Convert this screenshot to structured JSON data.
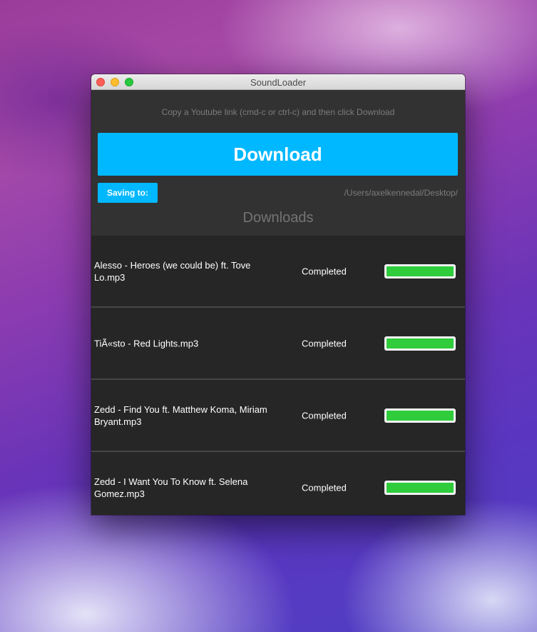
{
  "window": {
    "title": "SoundLoader"
  },
  "header": {
    "instruction": "Copy a Youtube link (cmd-c or ctrl-c) and then click Download",
    "download_label": "Download",
    "saving_label": "Saving to:",
    "save_path": "/Users/axelkennedal/Desktop/",
    "downloads_heading": "Downloads"
  },
  "downloads": [
    {
      "name": "Alesso - Heroes (we could be) ft. Tove Lo.mp3",
      "status": "Completed",
      "progress": 1.0
    },
    {
      "name": "TiÃ«sto - Red Lights.mp3",
      "status": "Completed",
      "progress": 1.0
    },
    {
      "name": "Zedd - Find You ft. Matthew Koma, Miriam Bryant.mp3",
      "status": "Completed",
      "progress": 1.0
    },
    {
      "name": "Zedd - I Want You To Know ft. Selena Gomez.mp3",
      "status": "Completed",
      "progress": 1.0
    }
  ],
  "colors": {
    "accent": "#00b8ff",
    "progress_fill": "#2fcc3c",
    "window_bg": "#323232",
    "list_bg": "#262626"
  }
}
